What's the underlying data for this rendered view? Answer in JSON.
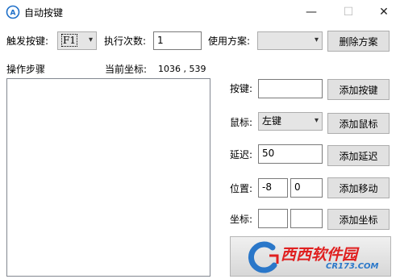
{
  "window": {
    "title": "自动按键",
    "minimize": "—",
    "maximize": "☐",
    "close": "✕"
  },
  "top_bar": {
    "trigger_label": "触发按键:",
    "trigger_value": "F1",
    "count_label": "执行次数:",
    "count_value": "1",
    "scheme_label": "使用方案:",
    "scheme_value": "",
    "delete_scheme_label": "删除方案"
  },
  "steps": {
    "label": "操作步骤",
    "coord_label": "当前坐标:",
    "coord_value": "1036 , 539"
  },
  "controls": {
    "key_label": "按键:",
    "key_value": "",
    "add_key_label": "添加按键",
    "mouse_label": "鼠标:",
    "mouse_value": "左键",
    "add_mouse_label": "添加鼠标",
    "delay_label": "延迟:",
    "delay_value": "50",
    "add_delay_label": "添加延迟",
    "position_label": "位置:",
    "position_x": "-8",
    "position_y": "0",
    "add_move_label": "添加移动",
    "coord_label": "坐标:",
    "coord_x": "",
    "coord_y": "",
    "add_coord_label": "添加坐标"
  },
  "watermark": {
    "brand": "西西软件园",
    "url": "CR173.COM"
  },
  "colors": {
    "button_bg": "#e1e1e1",
    "watermark_blue": "#2a77c9",
    "watermark_red": "#e02020"
  }
}
